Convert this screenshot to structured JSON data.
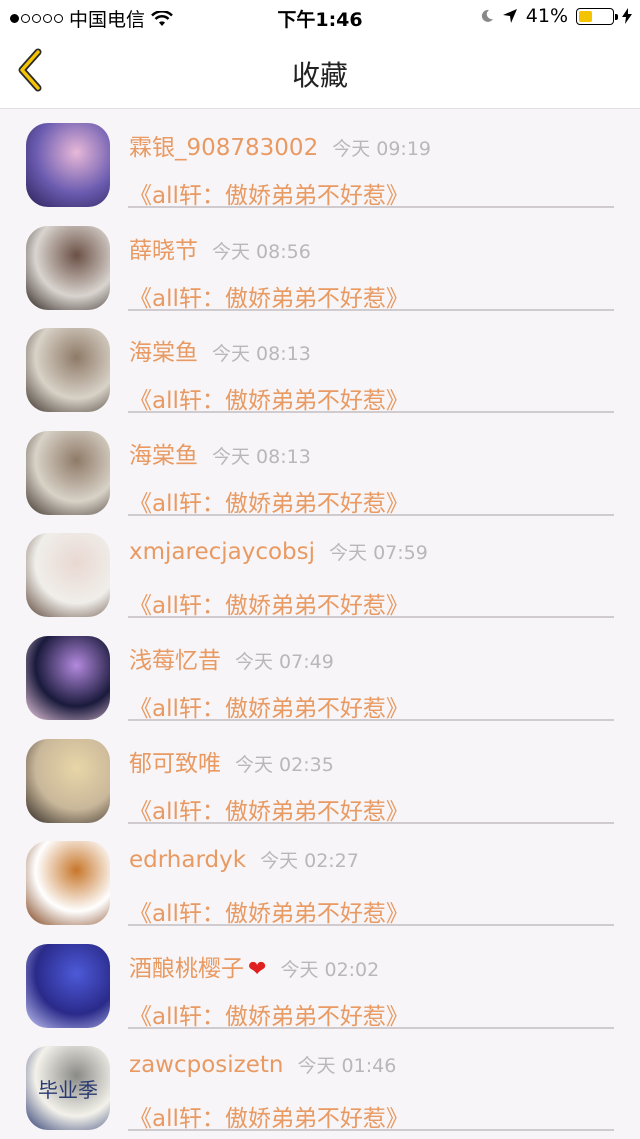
{
  "status_bar": {
    "carrier": "中国电信",
    "time": "下午1:46",
    "battery": "41%",
    "battery_level": 0.41,
    "signal_bars": 1
  },
  "nav": {
    "title": "收藏",
    "back_icon": "chevron-left-icon",
    "accent_color": "#f5c400"
  },
  "items": [
    {
      "name": "霖银_908783002",
      "time": "今天 09:19",
      "work": "《all轩：傲娇弟弟不好惹》",
      "avatar_colors": [
        "#6a5bb0",
        "#e8b8d8",
        "#2d1f55"
      ]
    },
    {
      "name": "薛晓节",
      "time": "今天 08:56",
      "work": "《all轩：傲娇弟弟不好惹》",
      "avatar_colors": [
        "#d9d4cf",
        "#6b5045",
        "#2a201c"
      ]
    },
    {
      "name": "海棠鱼",
      "time": "今天 08:13",
      "work": "《all轩：傲娇弟弟不好惹》",
      "avatar_colors": [
        "#d8d2c7",
        "#8f7a68",
        "#3b3029"
      ]
    },
    {
      "name": "海棠鱼",
      "time": "今天 08:13",
      "work": "《all轩：傲娇弟弟不好惹》",
      "avatar_colors": [
        "#d8d2c7",
        "#8f7a68",
        "#3b3029"
      ]
    },
    {
      "name": "xmjarecjaycobsj",
      "time": "今天 07:59",
      "work": "《all轩：傲娇弟弟不好惹》",
      "avatar_colors": [
        "#f0eeea",
        "#e9d8d2",
        "#5a4335"
      ]
    },
    {
      "name": "浅莓忆昔",
      "time": "今天 07:49",
      "work": "《all轩：傲娇弟弟不好惹》",
      "avatar_colors": [
        "#1a1a3c",
        "#b48adf",
        "#f2d0e6"
      ]
    },
    {
      "name": "郁可致唯",
      "time": "今天 02:35",
      "work": "《all轩：傲娇弟弟不好惹》",
      "avatar_colors": [
        "#c9b79a",
        "#e8d6a8",
        "#2b2520"
      ]
    },
    {
      "name": "edrhardyk",
      "time": "今天 02:27",
      "work": "《all轩：傲娇弟弟不好惹》",
      "avatar_colors": [
        "#ffffff",
        "#c7762a",
        "#7a3a12"
      ]
    },
    {
      "name": "酒酿桃樱子",
      "time": "今天 02:02",
      "work": "《all轩：傲娇弟弟不好惹》",
      "heart": "❤",
      "avatar_colors": [
        "#2a2a8a",
        "#4d5ad8",
        "#c7c9f5"
      ]
    },
    {
      "name": "zawcposizetn",
      "time": "今天 01:46",
      "work": "《all轩：傲娇弟弟不好惹》",
      "avatar_text": "毕业季",
      "avatar_colors": [
        "#f3f1ea",
        "#8a8a86",
        "#2a3a70"
      ]
    }
  ]
}
